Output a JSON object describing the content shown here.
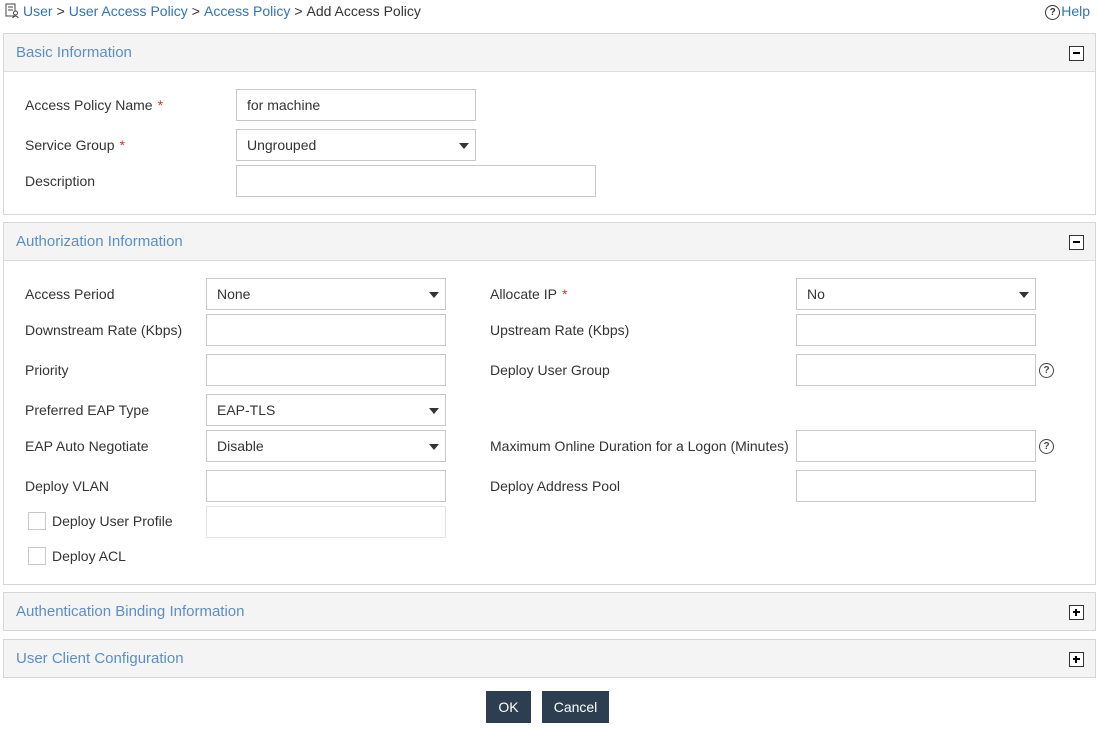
{
  "breadcrumb": {
    "items": [
      "User",
      "User Access Policy",
      "Access Policy"
    ],
    "current": "Add Access Policy",
    "separator": ">"
  },
  "help": {
    "label": "Help"
  },
  "basic": {
    "title": "Basic Information",
    "name_label": "Access Policy Name",
    "name_value": "for machine",
    "group_label": "Service Group",
    "group_value": "Ungrouped",
    "desc_label": "Description",
    "desc_value": "",
    "required_mark": "*"
  },
  "auth": {
    "title": "Authorization Information",
    "access_period_label": "Access Period",
    "access_period_value": "None",
    "allocate_ip_label": "Allocate IP",
    "allocate_ip_value": "No",
    "downstream_label": "Downstream Rate (Kbps)",
    "upstream_label": "Upstream Rate (Kbps)",
    "priority_label": "Priority",
    "deploy_user_group_label": "Deploy User Group",
    "eap_type_label": "Preferred EAP Type",
    "eap_type_value": "EAP-TLS",
    "eap_auto_label": "EAP Auto Negotiate",
    "eap_auto_value": "Disable",
    "max_online_label": "Maximum Online Duration for a Logon (Minutes)",
    "deploy_vlan_label": "Deploy VLAN",
    "deploy_addr_pool_label": "Deploy Address Pool",
    "deploy_user_profile_label": "Deploy User Profile",
    "deploy_acl_label": "Deploy ACL",
    "required_mark": "*",
    "help_glyph": "?"
  },
  "binding": {
    "title": "Authentication Binding Information"
  },
  "client": {
    "title": "User Client Configuration"
  },
  "actions": {
    "ok": "OK",
    "cancel": "Cancel"
  },
  "colors": {
    "link": "#2f74b5",
    "panel_title": "#5b8fc7",
    "required": "#d9302c",
    "button": "#2c3e50"
  },
  "icons": {
    "breadcrumb": "document-user-icon",
    "help": "question-circle-icon",
    "collapse": "minus-square-icon",
    "expand": "plus-square-icon"
  }
}
